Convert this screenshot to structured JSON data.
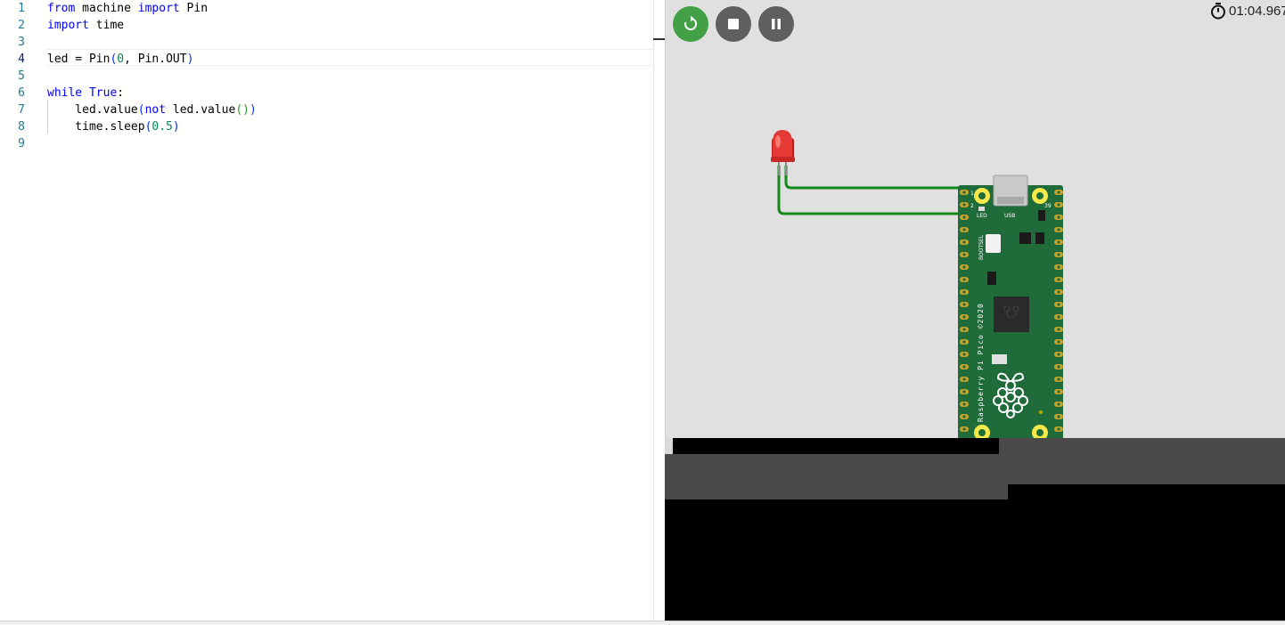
{
  "editor": {
    "lines": [
      {
        "n": "1",
        "tokens": [
          {
            "t": "from",
            "c": "kw"
          },
          {
            "t": " machine "
          },
          {
            "t": "import",
            "c": "kw"
          },
          {
            "t": " Pin"
          }
        ]
      },
      {
        "n": "2",
        "tokens": [
          {
            "t": "import",
            "c": "kw"
          },
          {
            "t": " time"
          }
        ]
      },
      {
        "n": "3",
        "tokens": []
      },
      {
        "n": "4",
        "tokens": [
          {
            "t": "led = Pin"
          },
          {
            "t": "(",
            "c": "b1"
          },
          {
            "t": "0",
            "c": "num"
          },
          {
            "t": ", Pin.OUT"
          },
          {
            "t": ")",
            "c": "b1"
          }
        ]
      },
      {
        "n": "5",
        "tokens": []
      },
      {
        "n": "6",
        "tokens": [
          {
            "t": "while",
            "c": "kw"
          },
          {
            "t": " "
          },
          {
            "t": "True",
            "c": "kw"
          },
          {
            "t": ":"
          }
        ]
      },
      {
        "n": "7",
        "tokens": [
          {
            "t": "    led.value"
          },
          {
            "t": "(",
            "c": "b1"
          },
          {
            "t": "not",
            "c": "kw"
          },
          {
            "t": " led.value"
          },
          {
            "t": "()",
            "c": "b2"
          },
          {
            "t": ")",
            "c": "b1"
          }
        ]
      },
      {
        "n": "8",
        "tokens": [
          {
            "t": "    time.sleep"
          },
          {
            "t": "(",
            "c": "b1"
          },
          {
            "t": "0.5",
            "c": "num"
          },
          {
            "t": ")",
            "c": "b1"
          }
        ]
      },
      {
        "n": "9",
        "tokens": []
      }
    ],
    "active_line": "4"
  },
  "simulator": {
    "timer": "01:04.967",
    "icons": {
      "restart": "restart-icon",
      "stop": "stop-icon",
      "pause": "pause-icon",
      "timer": "stopwatch-icon"
    },
    "led_color": "#e53935",
    "board": {
      "pin1": "1",
      "pin2": "2",
      "pin39": "39",
      "led_label": "LED",
      "usb_label": "USB",
      "bootsel_label": "BOOTSEL",
      "silkscreen": "Raspberry Pi Pico ©2020"
    }
  },
  "colors": {
    "accent_green": "#43a047",
    "control_gray": "#5f5f5f",
    "board_green": "#1f6b3a",
    "wire_green": "#148a1a",
    "pad_yellow": "#f5e84a"
  }
}
